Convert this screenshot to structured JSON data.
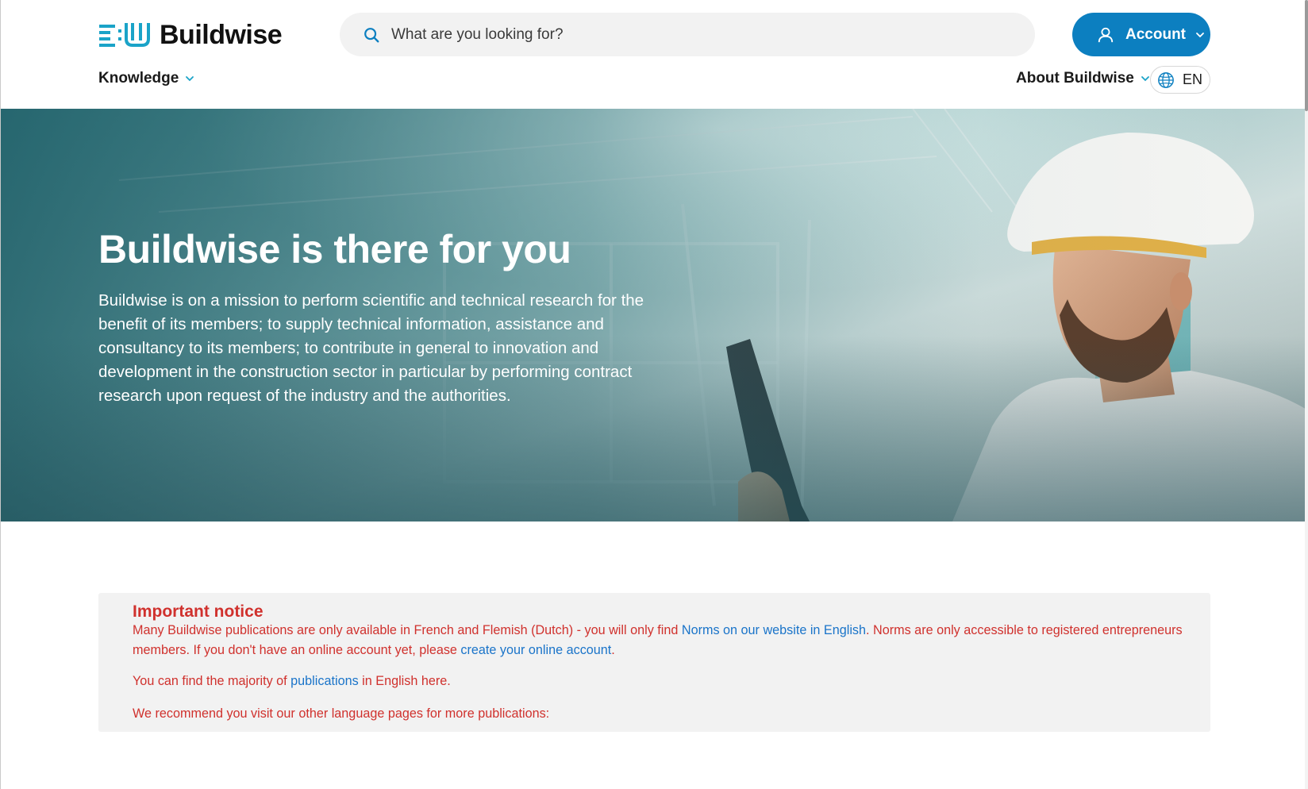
{
  "header": {
    "logo_text": "Buildwise",
    "search": {
      "placeholder": "What are you looking for?"
    },
    "account_label": "Account",
    "nav_knowledge": "Knowledge",
    "nav_about": "About Buildwise",
    "language": "EN"
  },
  "hero": {
    "title": "Buildwise is there for you",
    "text": "Buildwise is on a mission to perform scientific and technical research for the benefit of its members; to supply technical information, assistance and consultancy to its members; to contribute in general to innovation and development in the construction sector in particular by performing contract research upon request of the industry and the authorities."
  },
  "notice": {
    "title": "Important notice",
    "p1_a": "Many Buildwise publications are only available in French and Flemish (Dutch) - you will only find ",
    "p1_link1": "Norms on our website in English",
    "p1_b": ". Norms are only accessible to registered entrepreneurs members. If you don't have an online account yet, please ",
    "p1_link2": "create your online account",
    "p1_c": ".",
    "p2_a": "You can find the majority of ",
    "p2_link": "publications",
    "p2_b": " in English here.",
    "p3": "We recommend you visit our other language pages for more publications:"
  },
  "colors": {
    "brand_blue": "#0c7fc0",
    "notice_red": "#d0312d",
    "link_blue": "#1a74c9",
    "logo_teal": "#1aa3c8"
  },
  "icons": [
    "buildwise-logo-icon",
    "search-icon",
    "user-icon",
    "chevron-down-icon",
    "globe-icon"
  ]
}
